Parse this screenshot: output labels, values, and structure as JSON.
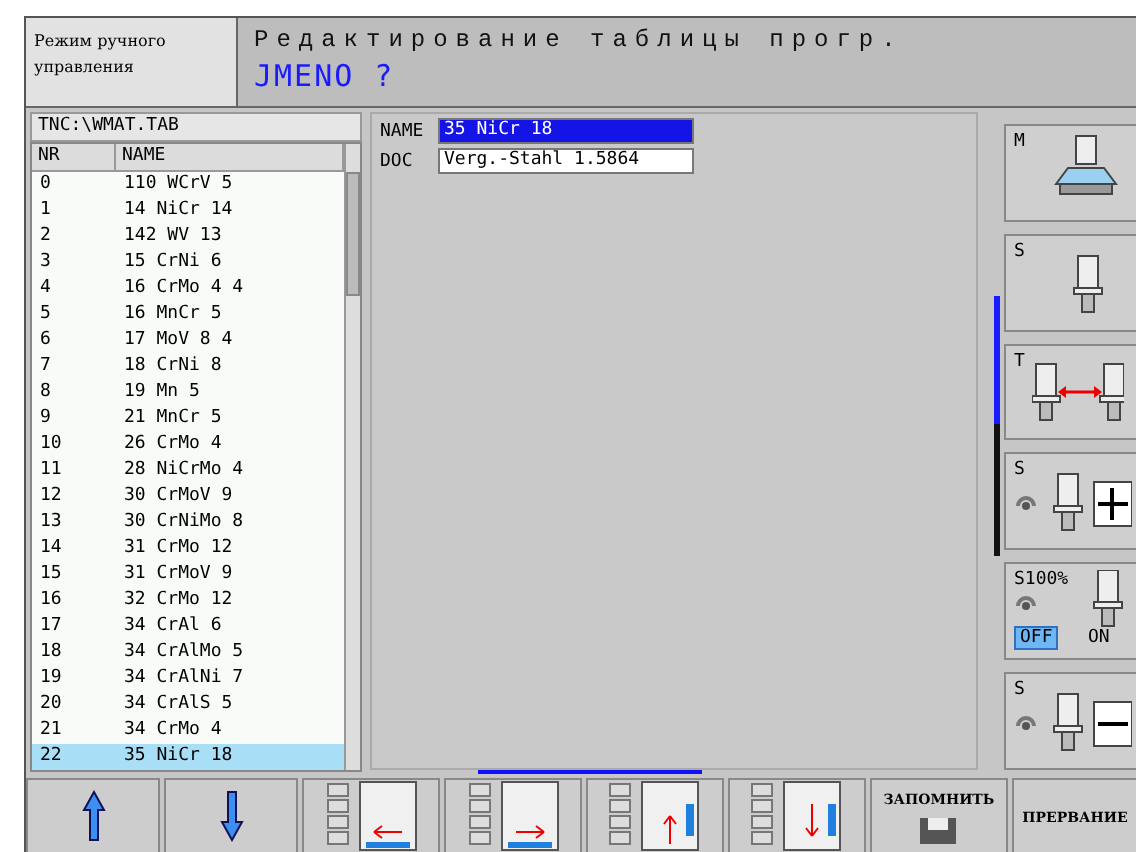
{
  "header": {
    "mode": "Режим ручного управления",
    "title": "Редактирование таблицы прогр.",
    "prompt": "JMENO ?"
  },
  "table": {
    "path": "TNC:\\WMAT.TAB",
    "columns": [
      "NR",
      "NAME"
    ],
    "rows": [
      {
        "nr": "0",
        "name": "110 WCrV 5",
        "selected": false
      },
      {
        "nr": "1",
        "name": "14 NiCr 14",
        "selected": false
      },
      {
        "nr": "2",
        "name": "142 WV 13",
        "selected": false
      },
      {
        "nr": "3",
        "name": "15 CrNi 6",
        "selected": false
      },
      {
        "nr": "4",
        "name": "16 CrMo 4 4",
        "selected": false
      },
      {
        "nr": "5",
        "name": "16 MnCr 5",
        "selected": false
      },
      {
        "nr": "6",
        "name": "17 MoV 8 4",
        "selected": false
      },
      {
        "nr": "7",
        "name": "18 CrNi 8",
        "selected": false
      },
      {
        "nr": "8",
        "name": "19 Mn 5",
        "selected": false
      },
      {
        "nr": "9",
        "name": "21 MnCr 5",
        "selected": false
      },
      {
        "nr": "10",
        "name": "26 CrMo 4",
        "selected": false
      },
      {
        "nr": "11",
        "name": "28 NiCrMo 4",
        "selected": false
      },
      {
        "nr": "12",
        "name": "30 CrMoV 9",
        "selected": false
      },
      {
        "nr": "13",
        "name": "30 CrNiMo 8",
        "selected": false
      },
      {
        "nr": "14",
        "name": "31 CrMo 12",
        "selected": false
      },
      {
        "nr": "15",
        "name": "31 CrMoV 9",
        "selected": false
      },
      {
        "nr": "16",
        "name": "32 CrMo 12",
        "selected": false
      },
      {
        "nr": "17",
        "name": "34 CrAl 6",
        "selected": false
      },
      {
        "nr": "18",
        "name": "34 CrAlMo 5",
        "selected": false
      },
      {
        "nr": "19",
        "name": "34 CrAlNi 7",
        "selected": false
      },
      {
        "nr": "20",
        "name": "34 CrAlS 5",
        "selected": false
      },
      {
        "nr": "21",
        "name": "34 CrMo 4",
        "selected": false
      },
      {
        "nr": "22",
        "name": "35 NiCr 18",
        "selected": true
      }
    ]
  },
  "form": {
    "fields": [
      {
        "label": "NAME",
        "value": "35 NiCr 18",
        "selected": true
      },
      {
        "label": "DOC",
        "value": "Verg.-Stahl 1.5864",
        "selected": false
      }
    ]
  },
  "side_keys": [
    {
      "kind": "table",
      "label": "M"
    },
    {
      "kind": "spindle",
      "label": "S"
    },
    {
      "kind": "swap",
      "label": "T"
    },
    {
      "kind": "plus",
      "label": "S"
    },
    {
      "kind": "override",
      "label": "S100%",
      "options": [
        {
          "label": "OFF",
          "selected": true
        },
        {
          "label": "ON",
          "selected": false
        }
      ]
    },
    {
      "kind": "minus",
      "label": "S"
    }
  ],
  "soft_keys": [
    {
      "kind": "up"
    },
    {
      "kind": "down"
    },
    {
      "kind": "left"
    },
    {
      "kind": "right"
    },
    {
      "kind": "pageup"
    },
    {
      "kind": "pagedown"
    },
    {
      "kind": "save",
      "label": "ЗАПОМНИТЬ"
    },
    {
      "kind": "text",
      "label": "ПРЕРВАНИЕ"
    }
  ]
}
